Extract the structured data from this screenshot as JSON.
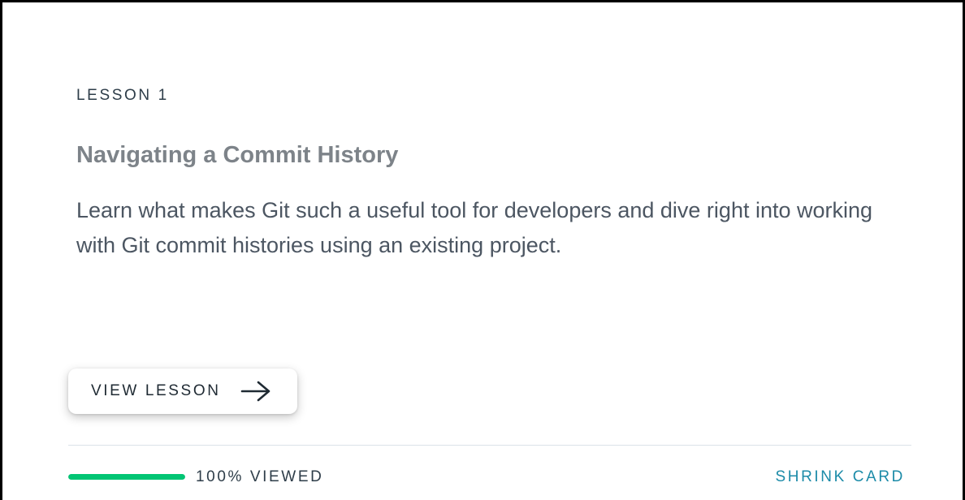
{
  "lesson": {
    "number_label": "LESSON 1",
    "title": "Navigating a Commit History",
    "description": "Learn what makes Git such a useful tool for developers and dive right into working with Git commit histories using an existing project."
  },
  "actions": {
    "view_lesson_label": "VIEW LESSON",
    "arrow_icon": "arrow-right-icon",
    "shrink_label": "SHRINK CARD"
  },
  "progress": {
    "percent": 100,
    "label": "100% VIEWED",
    "color": "#02c574"
  },
  "colors": {
    "link": "#1c8ba8",
    "title": "#7d8389",
    "text": "#4c5662"
  }
}
